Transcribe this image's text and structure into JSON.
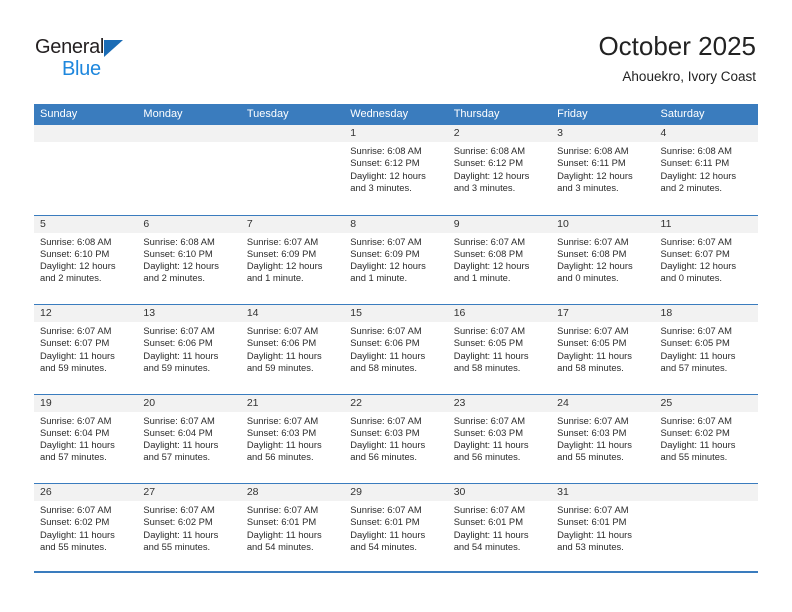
{
  "brand": {
    "name_part1": "General",
    "name_part2": "Blue",
    "triangle_color": "#1b6cb5",
    "blue_color": "#1e87dd"
  },
  "header": {
    "title": "October 2025",
    "subtitle": "Ahouekro, Ivory Coast"
  },
  "theme": {
    "header_blue": "#3a7cbe",
    "day_number_band": "#f2f2f2",
    "text": "#2b2b2b"
  },
  "weekdays": [
    "Sunday",
    "Monday",
    "Tuesday",
    "Wednesday",
    "Thursday",
    "Friday",
    "Saturday"
  ],
  "weeks": [
    [
      {
        "day": "",
        "sunrise": "",
        "sunset": "",
        "daylight": "",
        "daylight2": ""
      },
      {
        "day": "",
        "sunrise": "",
        "sunset": "",
        "daylight": "",
        "daylight2": ""
      },
      {
        "day": "",
        "sunrise": "",
        "sunset": "",
        "daylight": "",
        "daylight2": ""
      },
      {
        "day": "1",
        "sunrise": "Sunrise: 6:08 AM",
        "sunset": "Sunset: 6:12 PM",
        "daylight": "Daylight: 12 hours",
        "daylight2": "and 3 minutes."
      },
      {
        "day": "2",
        "sunrise": "Sunrise: 6:08 AM",
        "sunset": "Sunset: 6:12 PM",
        "daylight": "Daylight: 12 hours",
        "daylight2": "and 3 minutes."
      },
      {
        "day": "3",
        "sunrise": "Sunrise: 6:08 AM",
        "sunset": "Sunset: 6:11 PM",
        "daylight": "Daylight: 12 hours",
        "daylight2": "and 3 minutes."
      },
      {
        "day": "4",
        "sunrise": "Sunrise: 6:08 AM",
        "sunset": "Sunset: 6:11 PM",
        "daylight": "Daylight: 12 hours",
        "daylight2": "and 2 minutes."
      }
    ],
    [
      {
        "day": "5",
        "sunrise": "Sunrise: 6:08 AM",
        "sunset": "Sunset: 6:10 PM",
        "daylight": "Daylight: 12 hours",
        "daylight2": "and 2 minutes."
      },
      {
        "day": "6",
        "sunrise": "Sunrise: 6:08 AM",
        "sunset": "Sunset: 6:10 PM",
        "daylight": "Daylight: 12 hours",
        "daylight2": "and 2 minutes."
      },
      {
        "day": "7",
        "sunrise": "Sunrise: 6:07 AM",
        "sunset": "Sunset: 6:09 PM",
        "daylight": "Daylight: 12 hours",
        "daylight2": "and 1 minute."
      },
      {
        "day": "8",
        "sunrise": "Sunrise: 6:07 AM",
        "sunset": "Sunset: 6:09 PM",
        "daylight": "Daylight: 12 hours",
        "daylight2": "and 1 minute."
      },
      {
        "day": "9",
        "sunrise": "Sunrise: 6:07 AM",
        "sunset": "Sunset: 6:08 PM",
        "daylight": "Daylight: 12 hours",
        "daylight2": "and 1 minute."
      },
      {
        "day": "10",
        "sunrise": "Sunrise: 6:07 AM",
        "sunset": "Sunset: 6:08 PM",
        "daylight": "Daylight: 12 hours",
        "daylight2": "and 0 minutes."
      },
      {
        "day": "11",
        "sunrise": "Sunrise: 6:07 AM",
        "sunset": "Sunset: 6:07 PM",
        "daylight": "Daylight: 12 hours",
        "daylight2": "and 0 minutes."
      }
    ],
    [
      {
        "day": "12",
        "sunrise": "Sunrise: 6:07 AM",
        "sunset": "Sunset: 6:07 PM",
        "daylight": "Daylight: 11 hours",
        "daylight2": "and 59 minutes."
      },
      {
        "day": "13",
        "sunrise": "Sunrise: 6:07 AM",
        "sunset": "Sunset: 6:06 PM",
        "daylight": "Daylight: 11 hours",
        "daylight2": "and 59 minutes."
      },
      {
        "day": "14",
        "sunrise": "Sunrise: 6:07 AM",
        "sunset": "Sunset: 6:06 PM",
        "daylight": "Daylight: 11 hours",
        "daylight2": "and 59 minutes."
      },
      {
        "day": "15",
        "sunrise": "Sunrise: 6:07 AM",
        "sunset": "Sunset: 6:06 PM",
        "daylight": "Daylight: 11 hours",
        "daylight2": "and 58 minutes."
      },
      {
        "day": "16",
        "sunrise": "Sunrise: 6:07 AM",
        "sunset": "Sunset: 6:05 PM",
        "daylight": "Daylight: 11 hours",
        "daylight2": "and 58 minutes."
      },
      {
        "day": "17",
        "sunrise": "Sunrise: 6:07 AM",
        "sunset": "Sunset: 6:05 PM",
        "daylight": "Daylight: 11 hours",
        "daylight2": "and 58 minutes."
      },
      {
        "day": "18",
        "sunrise": "Sunrise: 6:07 AM",
        "sunset": "Sunset: 6:05 PM",
        "daylight": "Daylight: 11 hours",
        "daylight2": "and 57 minutes."
      }
    ],
    [
      {
        "day": "19",
        "sunrise": "Sunrise: 6:07 AM",
        "sunset": "Sunset: 6:04 PM",
        "daylight": "Daylight: 11 hours",
        "daylight2": "and 57 minutes."
      },
      {
        "day": "20",
        "sunrise": "Sunrise: 6:07 AM",
        "sunset": "Sunset: 6:04 PM",
        "daylight": "Daylight: 11 hours",
        "daylight2": "and 57 minutes."
      },
      {
        "day": "21",
        "sunrise": "Sunrise: 6:07 AM",
        "sunset": "Sunset: 6:03 PM",
        "daylight": "Daylight: 11 hours",
        "daylight2": "and 56 minutes."
      },
      {
        "day": "22",
        "sunrise": "Sunrise: 6:07 AM",
        "sunset": "Sunset: 6:03 PM",
        "daylight": "Daylight: 11 hours",
        "daylight2": "and 56 minutes."
      },
      {
        "day": "23",
        "sunrise": "Sunrise: 6:07 AM",
        "sunset": "Sunset: 6:03 PM",
        "daylight": "Daylight: 11 hours",
        "daylight2": "and 56 minutes."
      },
      {
        "day": "24",
        "sunrise": "Sunrise: 6:07 AM",
        "sunset": "Sunset: 6:03 PM",
        "daylight": "Daylight: 11 hours",
        "daylight2": "and 55 minutes."
      },
      {
        "day": "25",
        "sunrise": "Sunrise: 6:07 AM",
        "sunset": "Sunset: 6:02 PM",
        "daylight": "Daylight: 11 hours",
        "daylight2": "and 55 minutes."
      }
    ],
    [
      {
        "day": "26",
        "sunrise": "Sunrise: 6:07 AM",
        "sunset": "Sunset: 6:02 PM",
        "daylight": "Daylight: 11 hours",
        "daylight2": "and 55 minutes."
      },
      {
        "day": "27",
        "sunrise": "Sunrise: 6:07 AM",
        "sunset": "Sunset: 6:02 PM",
        "daylight": "Daylight: 11 hours",
        "daylight2": "and 55 minutes."
      },
      {
        "day": "28",
        "sunrise": "Sunrise: 6:07 AM",
        "sunset": "Sunset: 6:01 PM",
        "daylight": "Daylight: 11 hours",
        "daylight2": "and 54 minutes."
      },
      {
        "day": "29",
        "sunrise": "Sunrise: 6:07 AM",
        "sunset": "Sunset: 6:01 PM",
        "daylight": "Daylight: 11 hours",
        "daylight2": "and 54 minutes."
      },
      {
        "day": "30",
        "sunrise": "Sunrise: 6:07 AM",
        "sunset": "Sunset: 6:01 PM",
        "daylight": "Daylight: 11 hours",
        "daylight2": "and 54 minutes."
      },
      {
        "day": "31",
        "sunrise": "Sunrise: 6:07 AM",
        "sunset": "Sunset: 6:01 PM",
        "daylight": "Daylight: 11 hours",
        "daylight2": "and 53 minutes."
      },
      {
        "day": "",
        "sunrise": "",
        "sunset": "",
        "daylight": "",
        "daylight2": ""
      }
    ]
  ]
}
